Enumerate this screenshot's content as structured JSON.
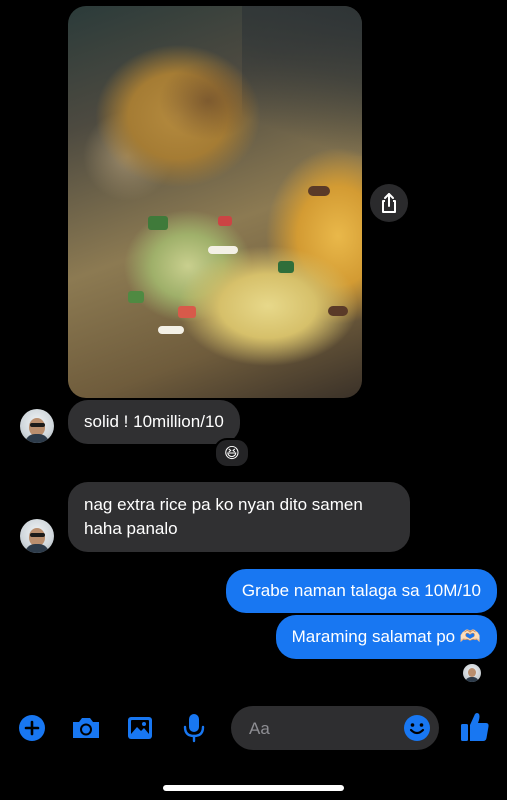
{
  "messages": {
    "incoming_1": "solid ! 10million/10",
    "incoming_1_reaction": "😆",
    "incoming_2_line1": "nag extra rice pa ko nyan dito samen",
    "incoming_2_line2": "haha panalo",
    "outgoing_1": "Grabe naman talaga sa 10M/10",
    "outgoing_2": "Maraming salamat po 🫶🏻"
  },
  "composer": {
    "placeholder": "Aa"
  },
  "icons": {
    "share": "share-icon",
    "add": "plus-circle-icon",
    "camera": "camera-icon",
    "gallery": "image-icon",
    "voice": "microphone-icon",
    "emoji": "emoji-icon",
    "like": "thumbs-up-icon"
  },
  "colors": {
    "accent": "#1877f2",
    "incoming_bubble": "#303032",
    "background": "#000000"
  }
}
